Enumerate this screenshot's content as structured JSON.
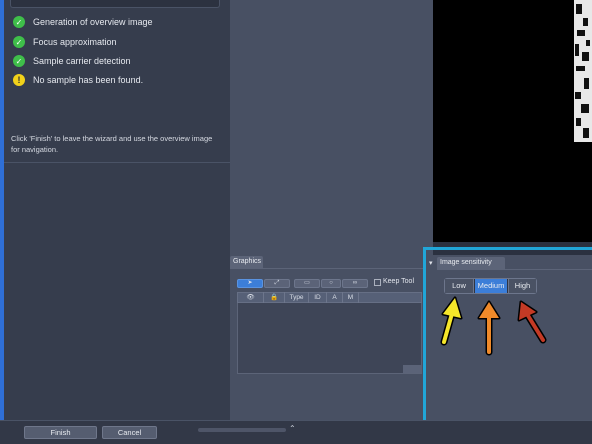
{
  "wizard": {
    "steps": [
      {
        "label": "Generation of overview image",
        "status": "done",
        "icon": "check-icon"
      },
      {
        "label": "Focus approximation",
        "status": "done",
        "icon": "check-icon"
      },
      {
        "label": "Sample carrier detection",
        "status": "done",
        "icon": "check-icon"
      },
      {
        "label": "No sample has been found.",
        "status": "warning",
        "icon": "warning-icon"
      }
    ],
    "finish_hint": "Click 'Finish' to leave the wizard and use the overview image for navigation."
  },
  "graphics": {
    "tab_label": "Graphics",
    "keep_tool_label": "Keep Tool",
    "columns": [
      "Type",
      "ID",
      "A",
      "M"
    ]
  },
  "sensitivity": {
    "tab_label": "Image sensitivity",
    "options": [
      "Low",
      "Medium",
      "High"
    ],
    "selected": "Medium"
  },
  "footer": {
    "finish_label": "Finish",
    "cancel_label": "Cancel"
  },
  "colors": {
    "accent_blue": "#3c7ed8",
    "highlight_frame": "#21a6d8",
    "check_green": "#3fbf4a",
    "warning_yellow": "#f2d21a",
    "arrow_yellow": "#f5e62a",
    "arrow_orange": "#f08a2a",
    "arrow_red": "#c43a25"
  }
}
